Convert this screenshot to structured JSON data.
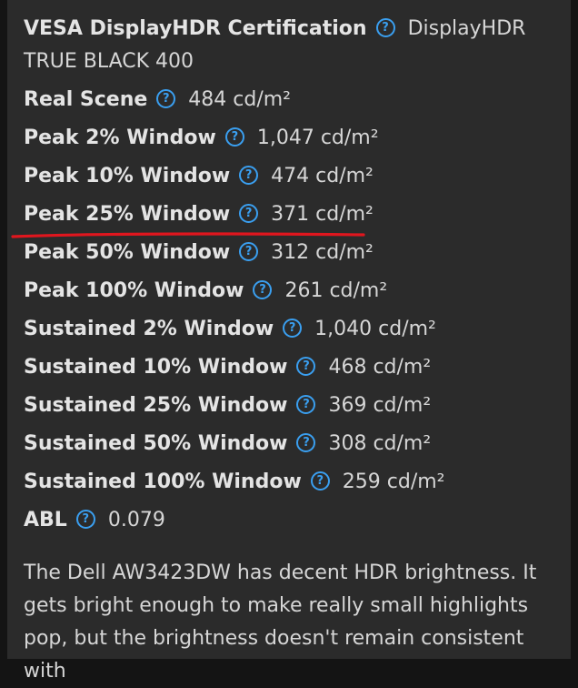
{
  "certification": {
    "label": "VESA DisplayHDR Certification",
    "value": "DisplayHDR TRUE BLACK 400"
  },
  "rows": [
    {
      "label": "Real Scene",
      "value": "484 cd/m²"
    },
    {
      "label": "Peak 2% Window",
      "value": "1,047 cd/m²"
    },
    {
      "label": "Peak 10% Window",
      "value": "474 cd/m²"
    },
    {
      "label": "Peak 25% Window",
      "value": "371 cd/m²",
      "highlighted": true
    },
    {
      "label": "Peak 50% Window",
      "value": "312 cd/m²"
    },
    {
      "label": "Peak 100% Window",
      "value": "261 cd/m²"
    },
    {
      "label": "Sustained 2% Window",
      "value": "1,040 cd/m²"
    },
    {
      "label": "Sustained 10% Window",
      "value": "468 cd/m²"
    },
    {
      "label": "Sustained 25% Window",
      "value": "369 cd/m²"
    },
    {
      "label": "Sustained 50% Window",
      "value": "308 cd/m²"
    },
    {
      "label": "Sustained 100% Window",
      "value": "259 cd/m²"
    },
    {
      "label": "ABL",
      "value": "0.079"
    }
  ],
  "help_icon": "question-circle-icon",
  "help_glyph": "?",
  "colors": {
    "background": "#2b2b2b",
    "help_icon": "#3a9ff0",
    "annotation": "#e0161e"
  },
  "description": "The Dell AW3423DW has decent HDR brightness. It gets bright enough to make really small highlights pop, but the brightness doesn't remain consistent with"
}
